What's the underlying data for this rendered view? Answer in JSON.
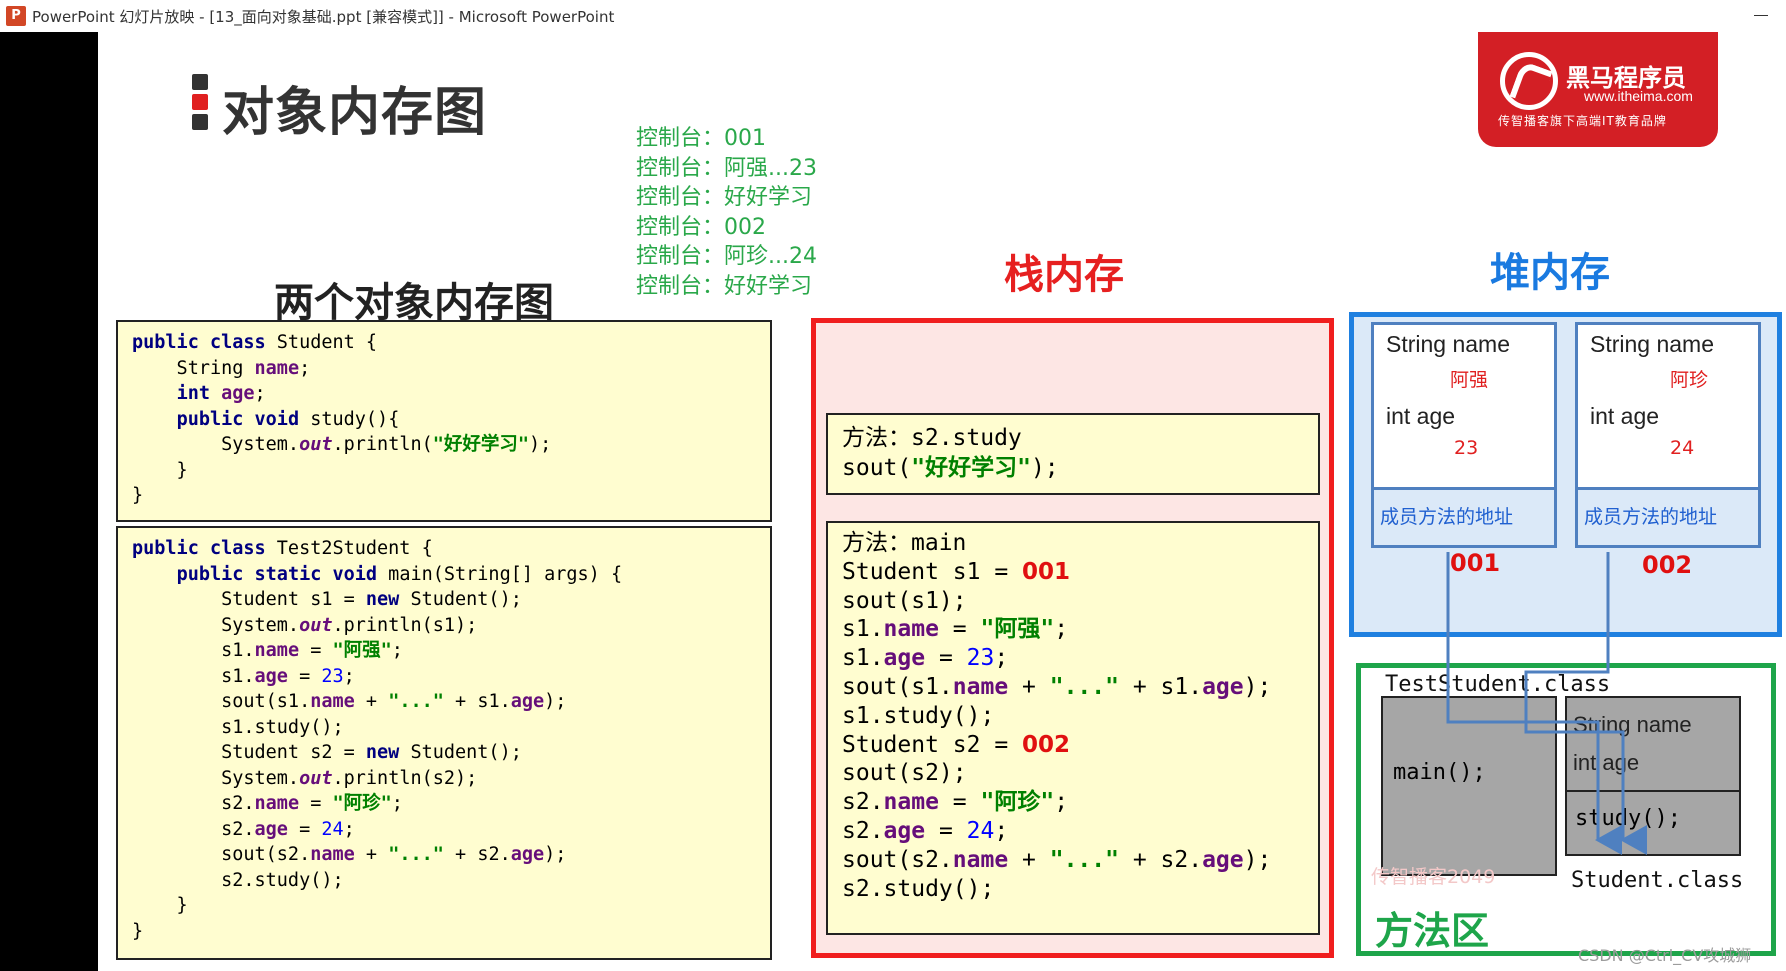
{
  "window": {
    "title": "PowerPoint 幻灯片放映 - [13_面向对象基础.ppt [兼容模式]] - Microsoft PowerPoint",
    "app_icon": "P"
  },
  "slide": {
    "title": "对象内存图",
    "subtitle": "两个对象内存图",
    "logo": {
      "brand": "黑马程序员",
      "url": "www.itheima.com",
      "tagline": "传智播客旗下高端IT教育品牌"
    },
    "console": [
      "控制台：001",
      "控制台：阿强...23",
      "控制台：好好学习",
      "控制台：002",
      "控制台：阿珍...24",
      "控制台：好好学习"
    ],
    "stack_title": "栈内存",
    "heap_title": "堆内存",
    "method_area_title": "方法区",
    "stack": {
      "frame_study": {
        "line1": "方法：s2.study",
        "line2_pre": "sout(",
        "line2_str": "\"好好学习\"",
        "line2_post": ");"
      },
      "frame_main": {
        "header": "方法：main",
        "s1_decl": "Student s1 = ",
        "s1_addr": "001",
        "s2_decl": "Student s2 = ",
        "s2_addr": "002"
      }
    },
    "heap": {
      "objects": [
        {
          "name_label": "String name",
          "name_value": "阿强",
          "age_label": "int age",
          "age_value": "23",
          "method_label": "成员方法的地址",
          "address": "001"
        },
        {
          "name_label": "String name",
          "name_value": "阿珍",
          "age_label": "int age",
          "age_value": "24",
          "method_label": "成员方法的地址",
          "address": "002"
        }
      ]
    },
    "method_area": {
      "class_label": "TestStudent.class",
      "main": "main();",
      "field1": "String name",
      "field2": "int age",
      "study": "study();",
      "student_class": "Student.class",
      "watermark": "传智播客2049"
    },
    "csdn_watermark": "CSDN @Ctrl_CV攻城狮"
  }
}
